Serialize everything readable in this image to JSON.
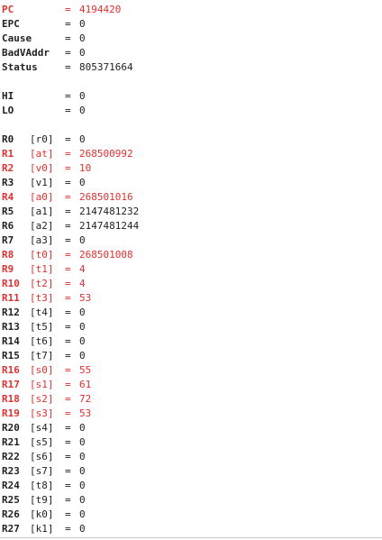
{
  "special_registers": [
    {
      "name": "PC",
      "value": "4194420",
      "changed": true
    },
    {
      "name": "EPC",
      "value": "0",
      "changed": false
    },
    {
      "name": "Cause",
      "value": "0",
      "changed": false
    },
    {
      "name": "BadVAddr",
      "value": "0",
      "changed": false
    },
    {
      "name": "Status",
      "value": "805371664",
      "changed": false
    }
  ],
  "hilo_registers": [
    {
      "name": "HI",
      "value": "0",
      "changed": false
    },
    {
      "name": "LO",
      "value": "0",
      "changed": false
    }
  ],
  "general_registers": [
    {
      "name": "R0",
      "alias": "[r0]",
      "value": "0",
      "changed": false
    },
    {
      "name": "R1",
      "alias": "[at]",
      "value": "268500992",
      "changed": true
    },
    {
      "name": "R2",
      "alias": "[v0]",
      "value": "10",
      "changed": true
    },
    {
      "name": "R3",
      "alias": "[v1]",
      "value": "0",
      "changed": false
    },
    {
      "name": "R4",
      "alias": "[a0]",
      "value": "268501016",
      "changed": true
    },
    {
      "name": "R5",
      "alias": "[a1]",
      "value": "2147481232",
      "changed": false
    },
    {
      "name": "R6",
      "alias": "[a2]",
      "value": "2147481244",
      "changed": false
    },
    {
      "name": "R7",
      "alias": "[a3]",
      "value": "0",
      "changed": false
    },
    {
      "name": "R8",
      "alias": "[t0]",
      "value": "268501008",
      "changed": true
    },
    {
      "name": "R9",
      "alias": "[t1]",
      "value": "4",
      "changed": true
    },
    {
      "name": "R10",
      "alias": "[t2]",
      "value": "4",
      "changed": true
    },
    {
      "name": "R11",
      "alias": "[t3]",
      "value": "53",
      "changed": true
    },
    {
      "name": "R12",
      "alias": "[t4]",
      "value": "0",
      "changed": false
    },
    {
      "name": "R13",
      "alias": "[t5]",
      "value": "0",
      "changed": false
    },
    {
      "name": "R14",
      "alias": "[t6]",
      "value": "0",
      "changed": false
    },
    {
      "name": "R15",
      "alias": "[t7]",
      "value": "0",
      "changed": false
    },
    {
      "name": "R16",
      "alias": "[s0]",
      "value": "55",
      "changed": true
    },
    {
      "name": "R17",
      "alias": "[s1]",
      "value": "61",
      "changed": true
    },
    {
      "name": "R18",
      "alias": "[s2]",
      "value": "72",
      "changed": true
    },
    {
      "name": "R19",
      "alias": "[s3]",
      "value": "53",
      "changed": true
    },
    {
      "name": "R20",
      "alias": "[s4]",
      "value": "0",
      "changed": false
    },
    {
      "name": "R21",
      "alias": "[s5]",
      "value": "0",
      "changed": false
    },
    {
      "name": "R22",
      "alias": "[s6]",
      "value": "0",
      "changed": false
    },
    {
      "name": "R23",
      "alias": "[s7]",
      "value": "0",
      "changed": false
    },
    {
      "name": "R24",
      "alias": "[t8]",
      "value": "0",
      "changed": false
    },
    {
      "name": "R25",
      "alias": "[t9]",
      "value": "0",
      "changed": false
    },
    {
      "name": "R26",
      "alias": "[k0]",
      "value": "0",
      "changed": false
    },
    {
      "name": "R27",
      "alias": "[k1]",
      "value": "0",
      "changed": false
    }
  ],
  "equals_sign": "=",
  "colors": {
    "changed": "#e03030",
    "normal": "#222222",
    "background": "#ffffff"
  }
}
